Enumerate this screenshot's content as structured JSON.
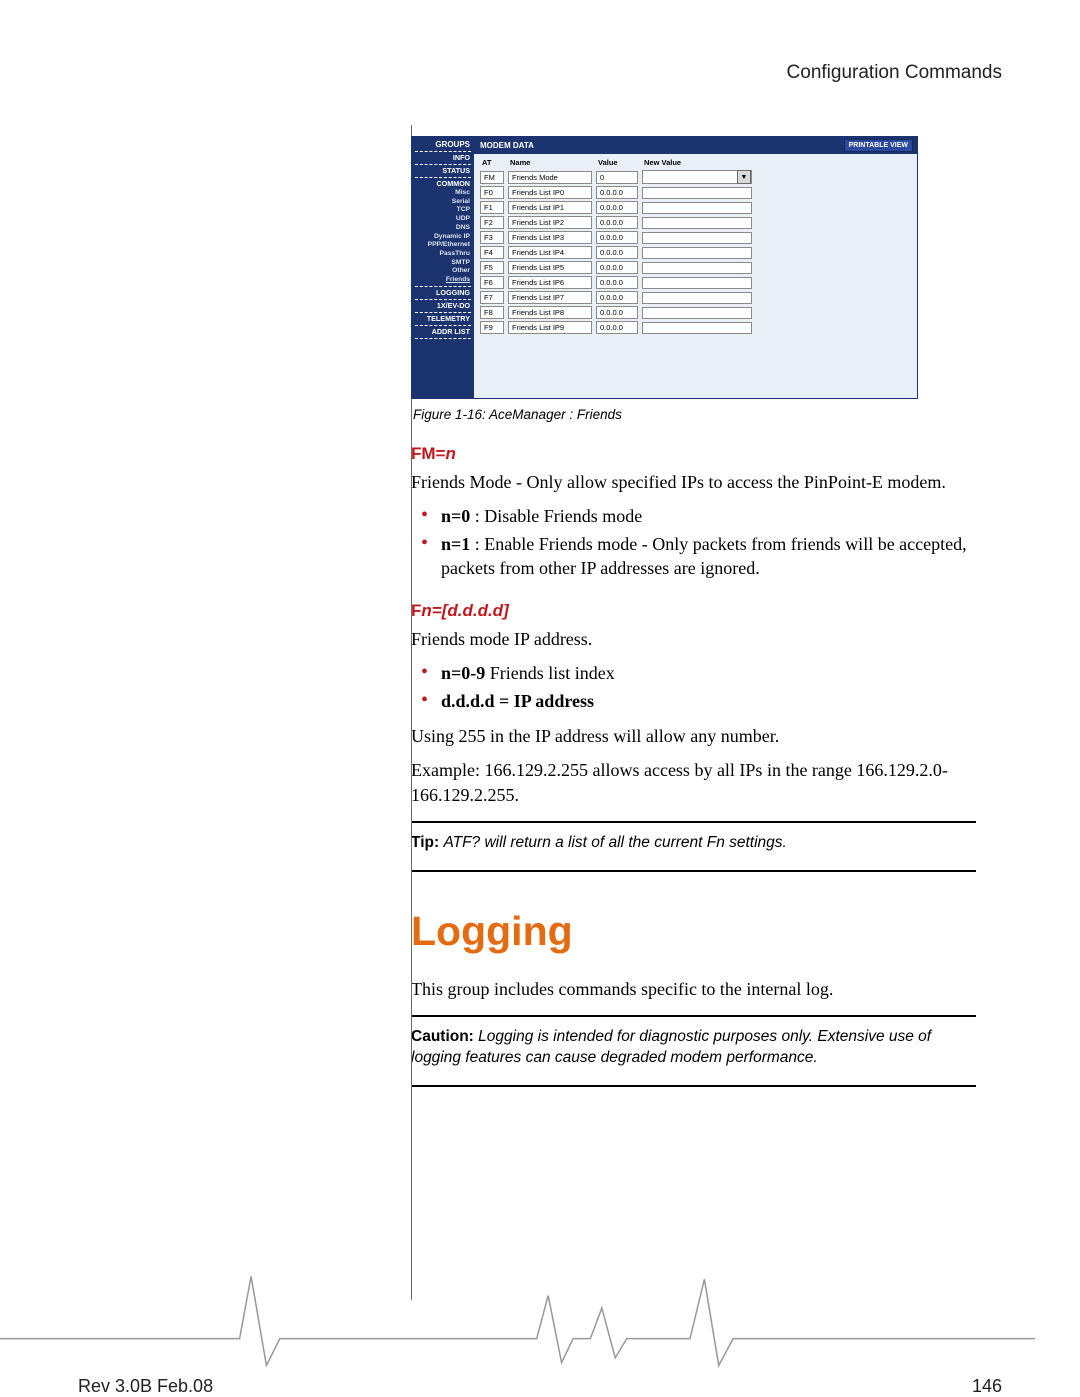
{
  "header": {
    "title": "Configuration Commands"
  },
  "aceman": {
    "groups_label": "GROUPS",
    "modem_data_label": "MODEM DATA",
    "printable_view": "PRINTABLE VIEW",
    "sidebar": {
      "info": "INFO",
      "status": "STATUS",
      "common": "COMMON",
      "subs": [
        "Misc",
        "Serial",
        "TCP",
        "UDP",
        "DNS",
        "Dynamic IP",
        "PPP/Ethernet",
        "PassThru",
        "SMTP",
        "Other",
        "Friends"
      ],
      "logging": "LOGGING",
      "evdo": "1X/EV-DO",
      "telemetry": "TELEMETRY",
      "addrlist": "ADDR LIST"
    },
    "columns": {
      "at": "AT",
      "name": "Name",
      "value": "Value",
      "new_value": "New Value"
    },
    "rows": [
      {
        "at": "FM",
        "name": "Friends Mode",
        "value": "0",
        "select": true
      },
      {
        "at": "F0",
        "name": "Friends List IP0",
        "value": "0.0.0.0",
        "select": false
      },
      {
        "at": "F1",
        "name": "Friends List IP1",
        "value": "0.0.0.0",
        "select": false
      },
      {
        "at": "F2",
        "name": "Friends List IP2",
        "value": "0.0.0.0",
        "select": false
      },
      {
        "at": "F3",
        "name": "Friends List IP3",
        "value": "0.0.0.0",
        "select": false
      },
      {
        "at": "F4",
        "name": "Friends List IP4",
        "value": "0.0.0.0",
        "select": false
      },
      {
        "at": "F5",
        "name": "Friends List IP5",
        "value": "0.0.0.0",
        "select": false
      },
      {
        "at": "F6",
        "name": "Friends List IP6",
        "value": "0.0.0.0",
        "select": false
      },
      {
        "at": "F7",
        "name": "Friends List IP7",
        "value": "0.0.0.0",
        "select": false
      },
      {
        "at": "F8",
        "name": "Friends List IP8",
        "value": "0.0.0.0",
        "select": false
      },
      {
        "at": "F9",
        "name": "Friends List IP9",
        "value": "0.0.0.0",
        "select": false
      }
    ]
  },
  "fig_caption": "Figure 1-16: AceManager : Friends",
  "cmd1": {
    "head_prefix": "FM=",
    "head_param": "n",
    "desc": "Friends Mode - Only allow specified IPs to access the PinPoint-E modem.",
    "li1_b": "n=0",
    "li1_t": " : Disable Friends mode",
    "li2_b": "n=1",
    "li2_t": " : Enable Friends mode - Only packets from friends will be accepted, packets from other IP addresses are ignored."
  },
  "cmd2": {
    "head_prefix": "F",
    "head_param": "n=[d.d.d.d]",
    "desc": "Friends mode IP address.",
    "li1_b": "n=0-9",
    "li1_t": " Friends list index",
    "li2_b": "d.d.d.d = IP address",
    "after1": "Using 255 in the IP address will allow any number.",
    "after2": "Example: 166.129.2.255 allows access by all IPs in the range 166.129.2.0-166.129.2.255."
  },
  "tip": {
    "label": "Tip: ",
    "text": "ATF? will return a list of all the current Fn settings."
  },
  "section2": {
    "title": "Logging",
    "body": "This group includes commands specific to the internal log."
  },
  "caution": {
    "label": "Caution: ",
    "text": "Logging is intended for diagnostic purposes only. Extensive use of logging features can cause degraded modem performance."
  },
  "footer": {
    "rev": "Rev 3.0B Feb.08",
    "page": "146"
  }
}
